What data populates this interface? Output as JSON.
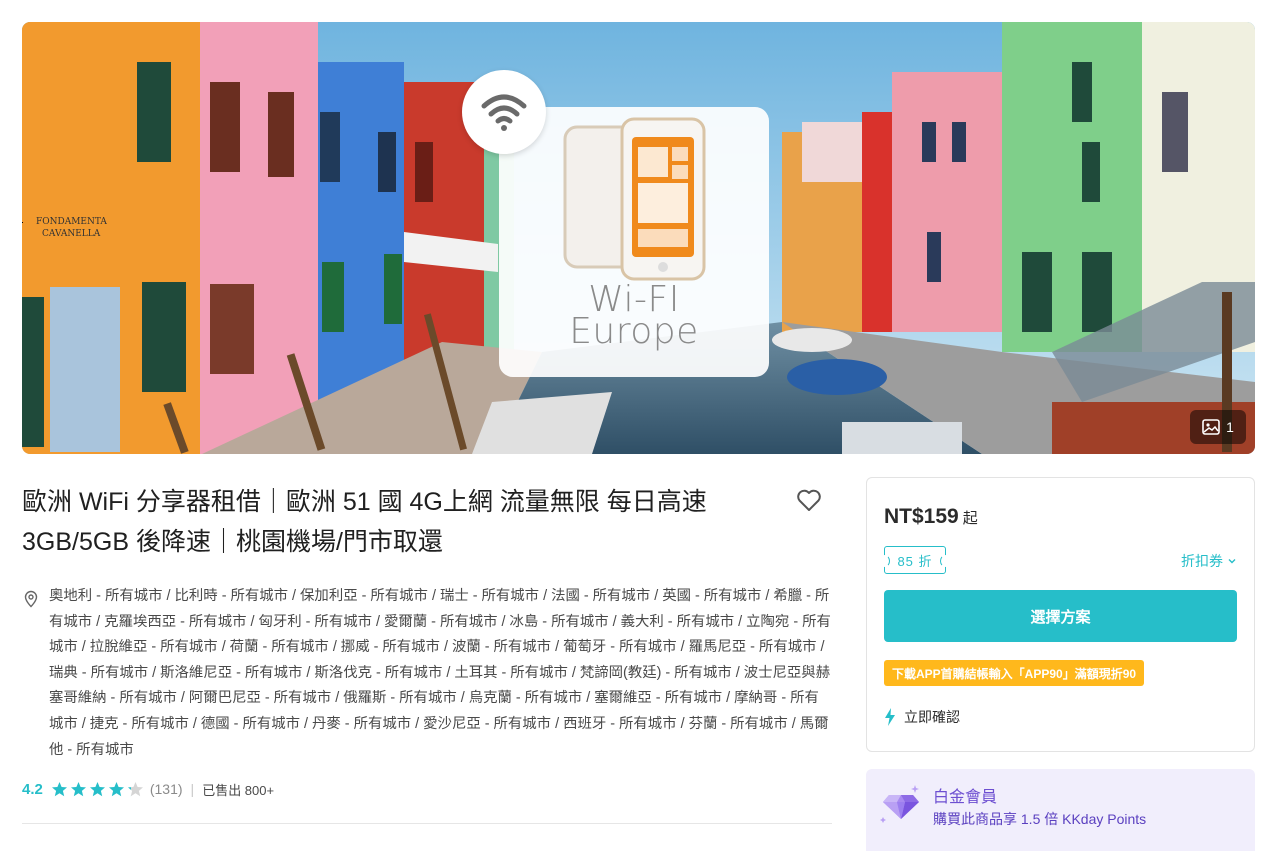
{
  "hero": {
    "card_title_line1": "Wi-FI",
    "card_title_line2": "Europe",
    "sign_line1": "FONDAMENTA",
    "sign_line2": "CAVANELLA",
    "image_count": "1",
    "icons": [
      "wifi-icon",
      "image-gallery-icon"
    ]
  },
  "product": {
    "title": "歐洲 WiFi 分享器租借｜歐洲 51 國 4G上網 流量無限 每日高速 3GB/5GB 後降速｜桃園機場/門市取還",
    "locations": "奧地利 - 所有城市 / 比利時 - 所有城市 / 保加利亞 - 所有城市 / 瑞士 - 所有城市 / 法國 - 所有城市 / 英國 - 所有城市 / 希臘 - 所有城市 / 克羅埃西亞 - 所有城市 / 匈牙利 - 所有城市 / 愛爾蘭 - 所有城市 / 冰島 - 所有城市 / 義大利 - 所有城市 / 立陶宛 - 所有城市 / 拉脫維亞 - 所有城市 / 荷蘭 - 所有城市 / 挪威 - 所有城市 / 波蘭 - 所有城市 / 葡萄牙 - 所有城市 / 羅馬尼亞 - 所有城市 / 瑞典 - 所有城市 / 斯洛維尼亞 - 所有城市 / 斯洛伐克 - 所有城市 / 土耳其 - 所有城市 / 梵諦岡(教廷) - 所有城市 / 波士尼亞與赫塞哥維納 - 所有城市 / 阿爾巴尼亞 - 所有城市 / 俄羅斯 - 所有城市 / 烏克蘭 - 所有城市 / 塞爾維亞 - 所有城市 / 摩納哥 - 所有城市 / 捷克 - 所有城市 / 德國 - 所有城市 / 丹麥 - 所有城市 / 愛沙尼亞 - 所有城市 / 西班牙 - 所有城市 / 芬蘭 - 所有城市 / 馬爾他 - 所有城市",
    "rating_score": "4.2",
    "rating_value": 4.2,
    "rating_max": 5,
    "rating_count": "(131)",
    "separator": "|",
    "sold": "已售出 800+"
  },
  "booking": {
    "price": "NT$159",
    "price_suffix": "起",
    "discount_tag": "85 折",
    "coupon_link": "折扣券",
    "select_button": "選擇方案",
    "promo": "下載APP首購結帳輸入「APP90」滿額現折90",
    "instant_confirm": "立即確認"
  },
  "member": {
    "title": "白金會員",
    "description": "購買此商品享 1.5 倍 KKday Points"
  },
  "colors": {
    "accent": "#26bec9",
    "promo": "#ffb81c",
    "member_bg": "#f1eefc",
    "member_text": "#6d4fd1"
  }
}
